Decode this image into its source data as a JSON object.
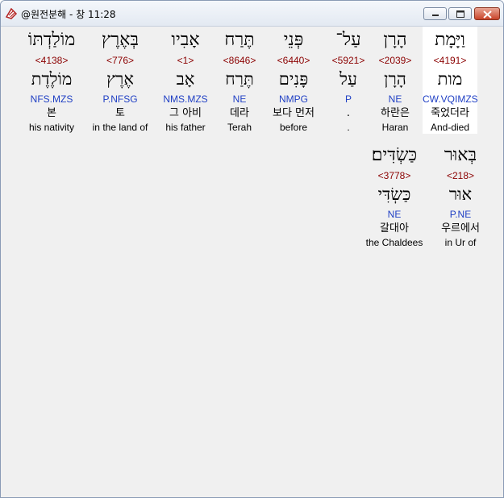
{
  "window": {
    "title": "@원전분해 - 창 11:28"
  },
  "words": [
    {
      "hebrew": "וַיָּמָת",
      "strong": "<4191>",
      "lemma": "מות",
      "morph": "CW.VQIMZS",
      "korean": "죽었더라",
      "english": "And-died"
    },
    {
      "hebrew": "הָרָן",
      "strong": "<2039>",
      "lemma": "הָרָן",
      "morph": "NE",
      "korean": "하란은",
      "english": "Haran"
    },
    {
      "hebrew": "עַל־",
      "strong": "<5921>",
      "lemma": "עַל",
      "morph": "P",
      "korean": ".",
      "english": "."
    },
    {
      "hebrew": "פְּנֵי",
      "strong": "<6440>",
      "lemma": "פָּנִים",
      "morph": "NMPG",
      "korean": "보다 먼저",
      "english": "before"
    },
    {
      "hebrew": "תֶּרַח",
      "strong": "<8646>",
      "lemma": "תֶּרַח",
      "morph": "NE",
      "korean": "데라",
      "english": "Terah"
    },
    {
      "hebrew": "אָבִיו",
      "strong": "<1>",
      "lemma": "אָב",
      "morph": "NMS.MZS",
      "korean": "그 아비",
      "english": "his father"
    },
    {
      "hebrew": "בְּאֶרֶץ",
      "strong": "<776>",
      "lemma": "אֶרֶץ",
      "morph": "P.NFSG",
      "korean": "토",
      "english": "in the land of"
    },
    {
      "hebrew": "מוֹלַדְתּוֹ",
      "strong": "<4138>",
      "lemma": "מוֹלֶדֶת",
      "morph": "NFS.MZS",
      "korean": "본",
      "english": "his nativity"
    },
    {
      "hebrew": "בְּאוּר",
      "strong": "<218>",
      "lemma": "אוּר",
      "morph": "P.NE",
      "korean": "우르에서",
      "english": "in Ur of"
    },
    {
      "hebrew": "כַּשְׂדִּים׃",
      "strong": "<3778>",
      "lemma": "כַּשְׂדִּי",
      "morph": "NE",
      "korean": "갈대아",
      "english": "the Chaldees"
    }
  ]
}
